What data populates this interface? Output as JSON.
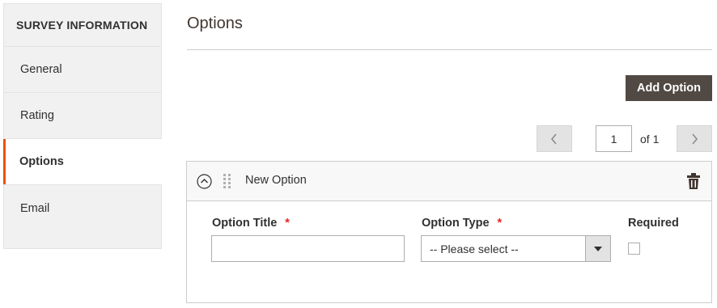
{
  "sidebar": {
    "heading": "SURVEY INFORMATION",
    "items": [
      {
        "label": "General"
      },
      {
        "label": "Rating"
      },
      {
        "label": "Options"
      },
      {
        "label": "Email"
      }
    ],
    "active_item": "Options",
    "accent_color": "#eb5202"
  },
  "main": {
    "title": "Options",
    "add_button_label": "Add Option",
    "add_button_color": "#514943",
    "pagination": {
      "current_page": "1",
      "of_label": "of 1"
    },
    "option_card": {
      "name": "New Option",
      "fields": {
        "option_title": {
          "label": "Option Title",
          "required_mark": "*",
          "value": ""
        },
        "option_type": {
          "label": "Option Type",
          "required_mark": "*",
          "selected": "-- Please select --"
        },
        "required": {
          "label": "Required",
          "checked": false
        }
      }
    },
    "icons": {
      "collapse": "collapse-circle-icon",
      "drag": "drag-handle-icon",
      "delete": "trash-icon",
      "prev": "chevron-left-icon",
      "next": "chevron-right-icon",
      "select_arrow": "caret-down-icon"
    }
  }
}
